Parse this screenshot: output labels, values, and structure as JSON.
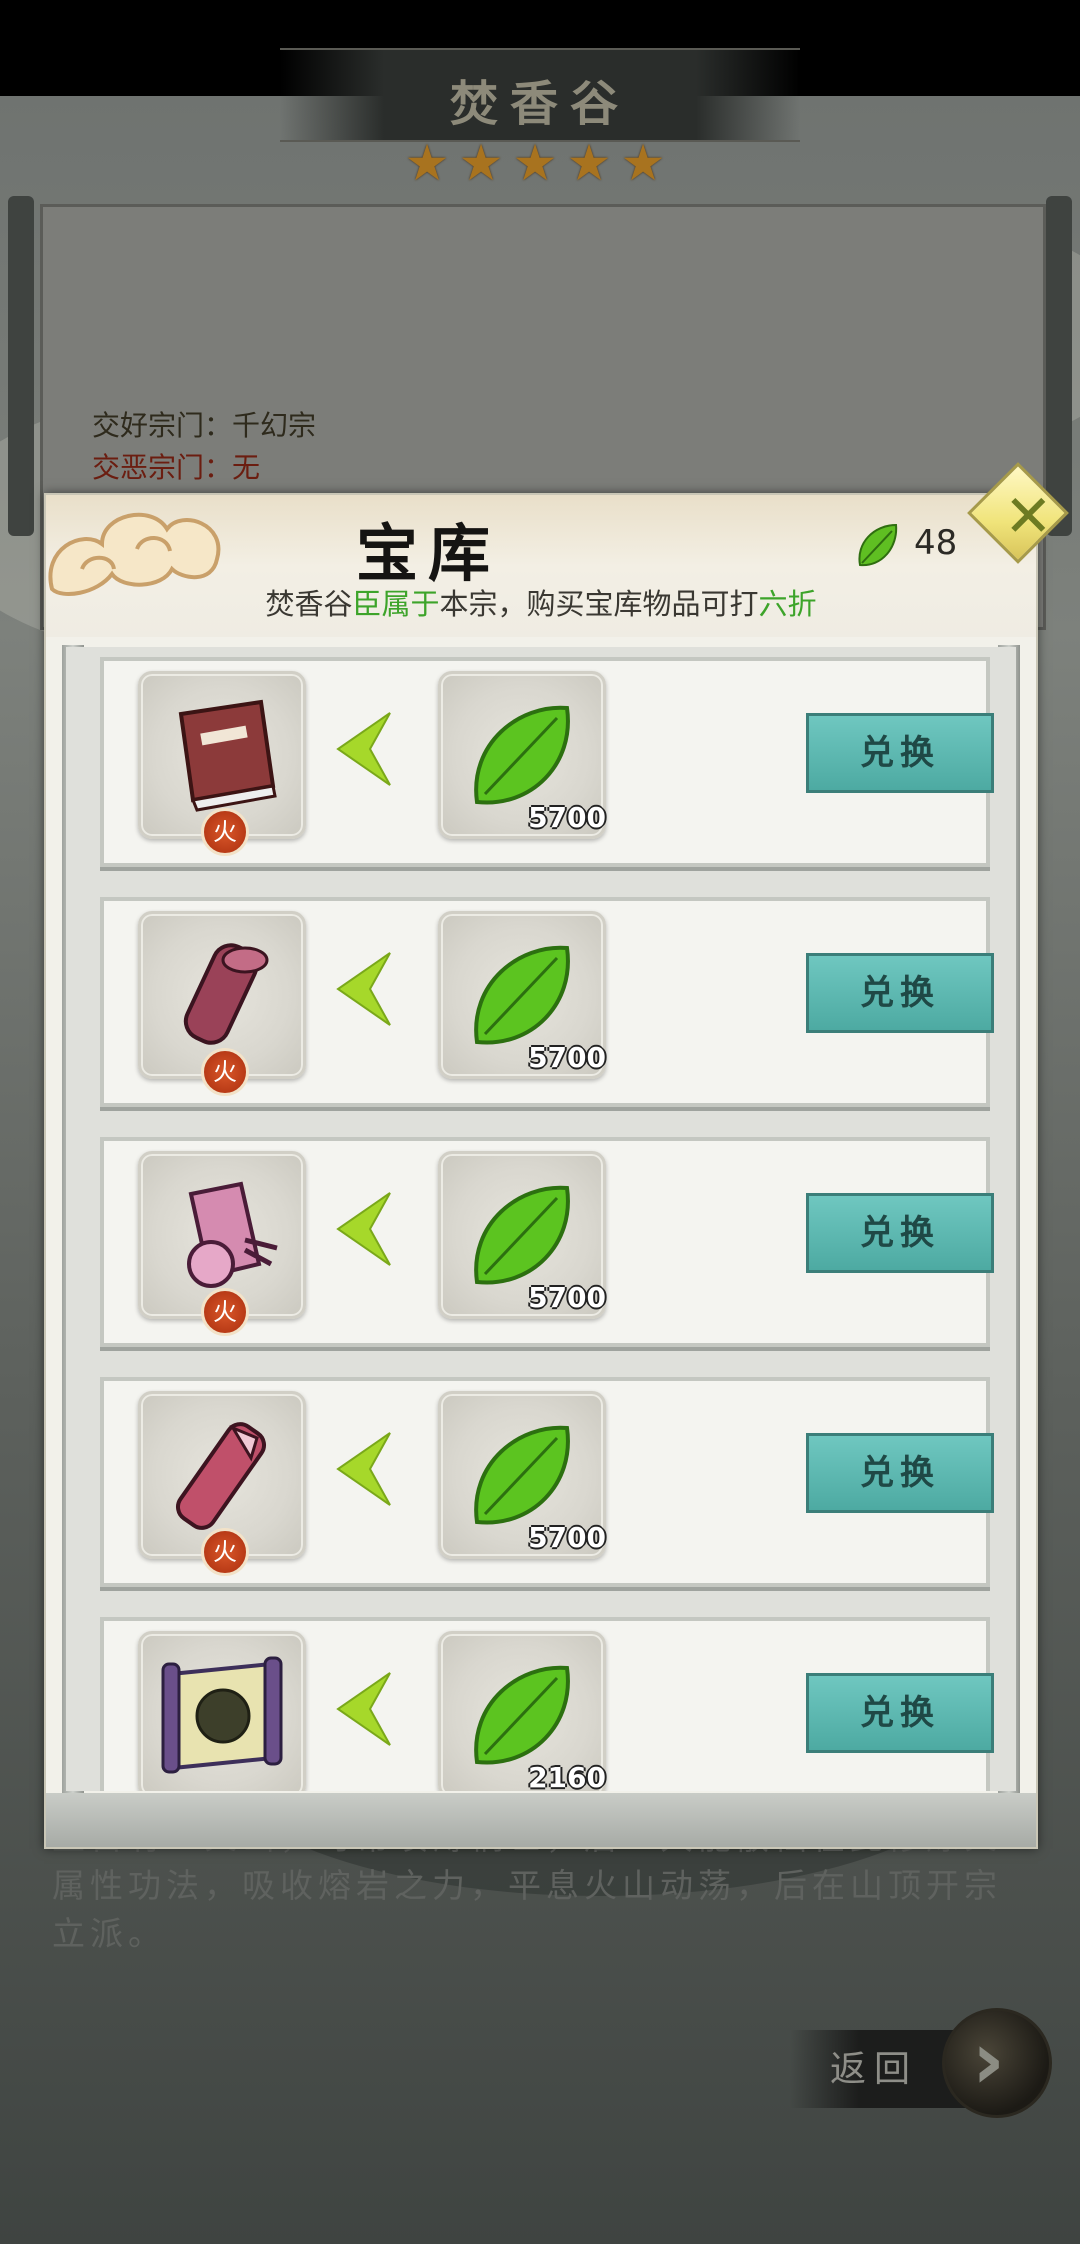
{
  "sect": {
    "name": "焚香谷",
    "stars": [
      "★",
      "★",
      "★",
      "★",
      "★"
    ],
    "friendly_label": "交好宗门：",
    "friendly_value": "千幻宗",
    "hostile_label": "交恶宗门：",
    "hostile_value": "无",
    "description": "上古有一火山，时常喷薄祸世，后一大能散仙在此修炼火属性功法，吸收熔岩之力，平息火山动荡，后在山顶开宗立派。"
  },
  "return_label": "返回",
  "treasury": {
    "title": "宝库",
    "currency_icon": "green-leaf-icon",
    "currency_count": "48",
    "subline_parts": [
      "焚香谷",
      "臣属于",
      "本宗，购买宝库物品可打",
      "六折"
    ],
    "close_icon": "close-x-icon"
  },
  "items": [
    {
      "item_icon": "red-book-icon",
      "badge": "火",
      "cost": "5700",
      "button": "兑换"
    },
    {
      "item_icon": "red-scroll-icon",
      "badge": "火",
      "cost": "5700",
      "button": "兑换"
    },
    {
      "item_icon": "pink-scroll-icon",
      "badge": "火",
      "cost": "5700",
      "button": "兑换"
    },
    {
      "item_icon": "bound-scroll-icon",
      "badge": "火",
      "cost": "5700",
      "button": "兑换"
    },
    {
      "item_icon": "parchment-scroll-icon",
      "badge": "",
      "cost": "2160",
      "button": "兑换"
    }
  ],
  "colors": {
    "accent_green": "#3da42a",
    "button_teal": "#56b2aa",
    "fire_badge": "#c2441c"
  }
}
